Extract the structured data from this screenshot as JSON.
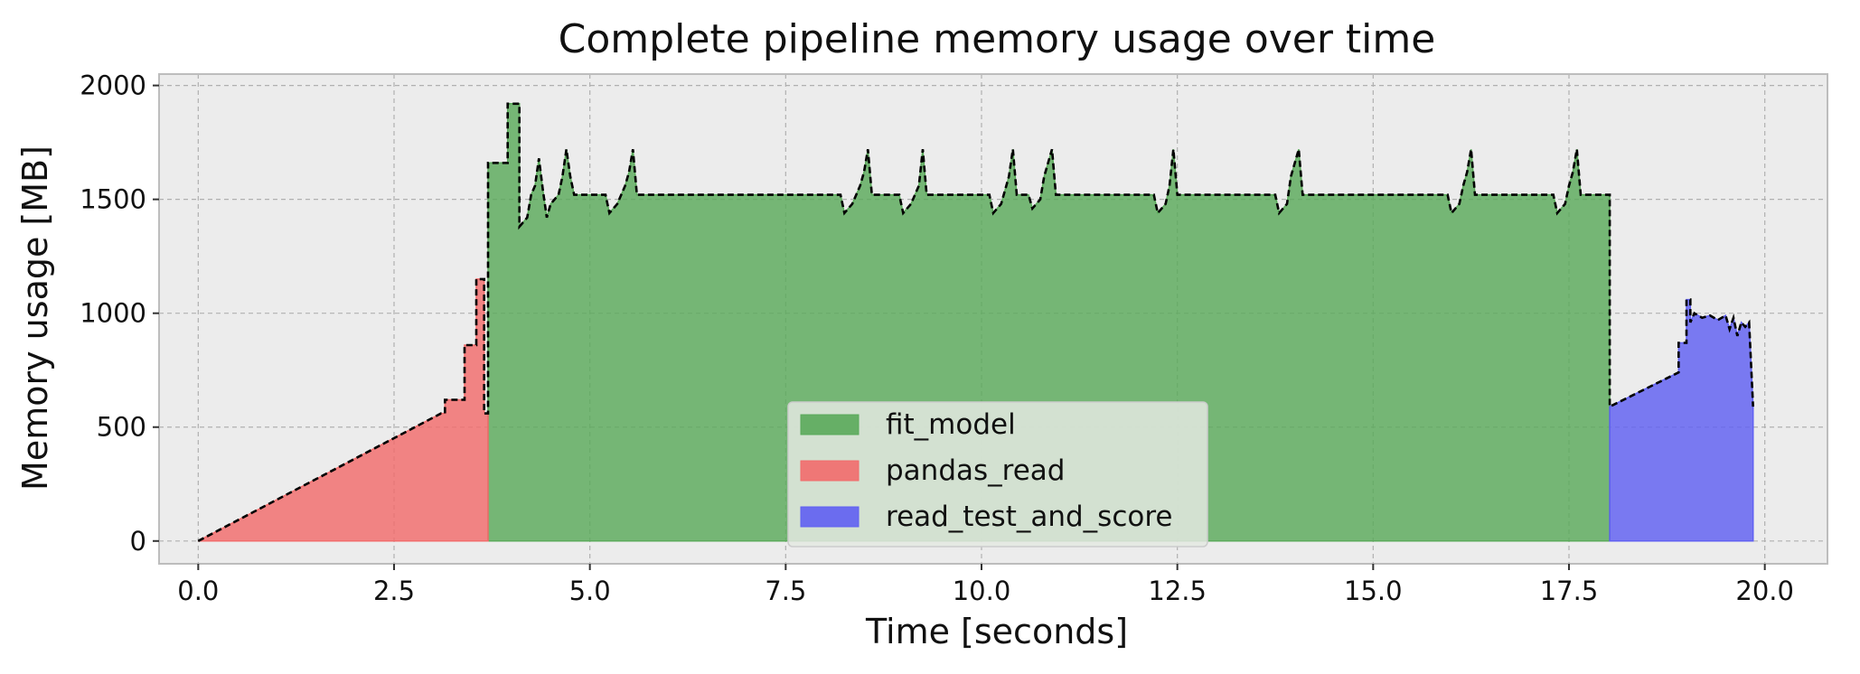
{
  "chart_data": {
    "type": "area",
    "title": "Complete pipeline memory usage over time",
    "xlabel": "Time [seconds]",
    "ylabel": "Memory usage [MB]",
    "xlim": [
      -0.5,
      20.8
    ],
    "ylim": [
      -100,
      2050
    ],
    "xticks": [
      0.0,
      2.5,
      5.0,
      7.5,
      10.0,
      12.5,
      15.0,
      17.5,
      20.0
    ],
    "xtick_labels": [
      "0.0",
      "2.5",
      "5.0",
      "7.5",
      "10.0",
      "12.5",
      "15.0",
      "17.5",
      "20.0"
    ],
    "yticks": [
      0,
      500,
      1000,
      1500,
      2000
    ],
    "ytick_labels": [
      "0",
      "500",
      "1000",
      "1500",
      "2000"
    ],
    "grid": true,
    "legend_position": "lower-center",
    "background": "#ececec",
    "series": [
      {
        "name": "fit_model",
        "color": "#5aaa5a",
        "points": [
          [
            3.7,
            0
          ],
          [
            3.7,
            1660
          ],
          [
            3.95,
            1660
          ],
          [
            3.95,
            1920
          ],
          [
            4.1,
            1920
          ],
          [
            4.1,
            1380
          ],
          [
            4.2,
            1420
          ],
          [
            4.25,
            1520
          ],
          [
            4.3,
            1560
          ],
          [
            4.35,
            1680
          ],
          [
            4.4,
            1540
          ],
          [
            4.45,
            1420
          ],
          [
            4.5,
            1480
          ],
          [
            4.6,
            1520
          ],
          [
            4.65,
            1600
          ],
          [
            4.7,
            1720
          ],
          [
            4.75,
            1600
          ],
          [
            4.8,
            1520
          ],
          [
            5.2,
            1520
          ],
          [
            5.25,
            1440
          ],
          [
            5.35,
            1480
          ],
          [
            5.45,
            1560
          ],
          [
            5.5,
            1620
          ],
          [
            5.55,
            1720
          ],
          [
            5.6,
            1520
          ],
          [
            8.2,
            1520
          ],
          [
            8.25,
            1440
          ],
          [
            8.35,
            1480
          ],
          [
            8.45,
            1560
          ],
          [
            8.5,
            1620
          ],
          [
            8.55,
            1720
          ],
          [
            8.6,
            1520
          ],
          [
            8.95,
            1520
          ],
          [
            9.0,
            1440
          ],
          [
            9.1,
            1480
          ],
          [
            9.2,
            1560
          ],
          [
            9.25,
            1720
          ],
          [
            9.3,
            1520
          ],
          [
            10.1,
            1520
          ],
          [
            10.15,
            1440
          ],
          [
            10.25,
            1480
          ],
          [
            10.3,
            1540
          ],
          [
            10.35,
            1600
          ],
          [
            10.4,
            1720
          ],
          [
            10.45,
            1520
          ],
          [
            10.6,
            1520
          ],
          [
            10.65,
            1460
          ],
          [
            10.75,
            1500
          ],
          [
            10.8,
            1600
          ],
          [
            10.9,
            1720
          ],
          [
            10.95,
            1520
          ],
          [
            12.2,
            1520
          ],
          [
            12.25,
            1440
          ],
          [
            12.35,
            1480
          ],
          [
            12.4,
            1560
          ],
          [
            12.45,
            1720
          ],
          [
            12.5,
            1520
          ],
          [
            13.75,
            1520
          ],
          [
            13.8,
            1440
          ],
          [
            13.9,
            1480
          ],
          [
            13.95,
            1600
          ],
          [
            14.05,
            1720
          ],
          [
            14.1,
            1520
          ],
          [
            15.95,
            1520
          ],
          [
            16.0,
            1440
          ],
          [
            16.1,
            1480
          ],
          [
            16.15,
            1560
          ],
          [
            16.2,
            1620
          ],
          [
            16.25,
            1720
          ],
          [
            16.3,
            1520
          ],
          [
            17.3,
            1520
          ],
          [
            17.35,
            1440
          ],
          [
            17.45,
            1480
          ],
          [
            17.5,
            1560
          ],
          [
            17.55,
            1620
          ],
          [
            17.6,
            1720
          ],
          [
            17.65,
            1520
          ],
          [
            18.02,
            1520
          ],
          [
            18.02,
            0
          ]
        ]
      },
      {
        "name": "pandas_read",
        "color": "#f26b6b",
        "points": [
          [
            0.0,
            0
          ],
          [
            3.1,
            560
          ],
          [
            3.15,
            560
          ],
          [
            3.15,
            620
          ],
          [
            3.4,
            620
          ],
          [
            3.4,
            860
          ],
          [
            3.55,
            860
          ],
          [
            3.55,
            1150
          ],
          [
            3.65,
            1150
          ],
          [
            3.65,
            560
          ],
          [
            3.7,
            560
          ],
          [
            3.7,
            0
          ]
        ]
      },
      {
        "name": "read_test_and_score",
        "color": "#5f5ff2",
        "points": [
          [
            18.02,
            0
          ],
          [
            18.02,
            590
          ],
          [
            18.9,
            740
          ],
          [
            18.9,
            870
          ],
          [
            19.0,
            870
          ],
          [
            19.0,
            1060
          ],
          [
            19.05,
            1060
          ],
          [
            19.05,
            960
          ],
          [
            19.1,
            1000
          ],
          [
            19.2,
            980
          ],
          [
            19.3,
            990
          ],
          [
            19.4,
            970
          ],
          [
            19.5,
            990
          ],
          [
            19.55,
            930
          ],
          [
            19.6,
            980
          ],
          [
            19.65,
            900
          ],
          [
            19.7,
            960
          ],
          [
            19.75,
            940
          ],
          [
            19.8,
            960
          ],
          [
            19.85,
            590
          ],
          [
            19.85,
            0
          ]
        ]
      }
    ]
  }
}
